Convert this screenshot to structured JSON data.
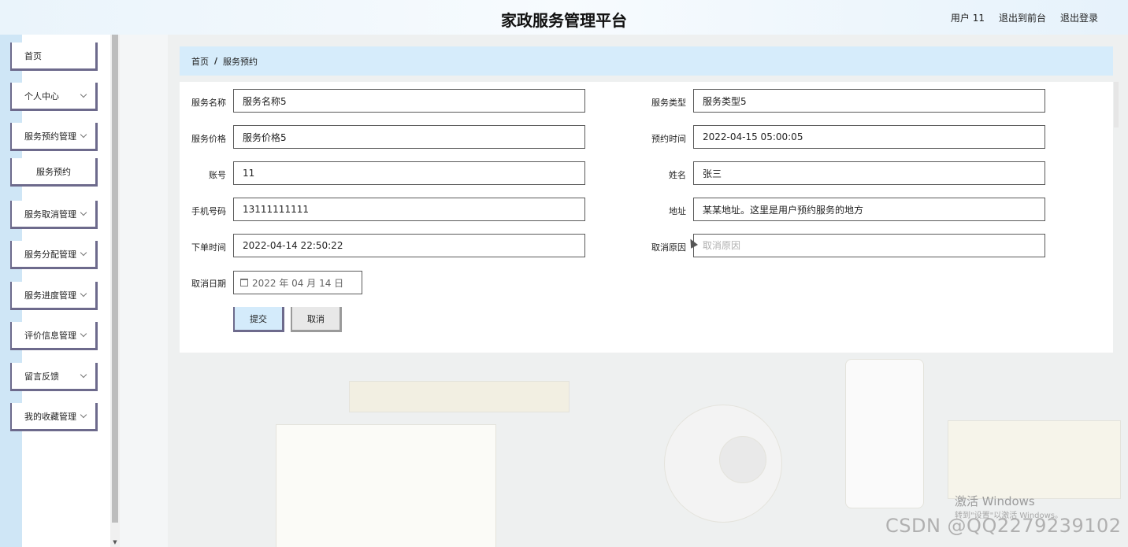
{
  "header": {
    "title": "家政服务管理平台",
    "user": "用户 11",
    "to_front": "退出到前台",
    "logout": "退出登录"
  },
  "sidebar": {
    "items": [
      {
        "label": "首页"
      },
      {
        "label": "个人中心"
      },
      {
        "label": "服务预约管理"
      },
      {
        "label": "服务预约"
      },
      {
        "label": "服务取消管理"
      },
      {
        "label": "服务分配管理"
      },
      {
        "label": "服务进度管理"
      },
      {
        "label": "评价信息管理"
      },
      {
        "label": "留言反馈"
      },
      {
        "label": "我的收藏管理"
      }
    ]
  },
  "breadcrumb": {
    "home": "首页",
    "separator": "/",
    "current": "服务预约"
  },
  "form": {
    "service_name": {
      "label": "服务名称",
      "value": "服务名称5"
    },
    "service_type": {
      "label": "服务类型",
      "value": "服务类型5"
    },
    "service_price": {
      "label": "服务价格",
      "value": "服务价格5"
    },
    "booking_time": {
      "label": "预约时间",
      "value": "2022-04-15 05:00:05"
    },
    "account": {
      "label": "账号",
      "value": "11"
    },
    "name": {
      "label": "姓名",
      "value": "张三"
    },
    "phone": {
      "label": "手机号码",
      "value": "13111111111"
    },
    "address": {
      "label": "地址",
      "value": "某某地址。这里是用户预约服务的地方"
    },
    "order_time": {
      "label": "下单时间",
      "value": "2022-04-14 22:50:22"
    },
    "cancel_reason": {
      "label": "取消原因",
      "value": "",
      "placeholder": "取消原因"
    },
    "cancel_date": {
      "label": "取消日期",
      "value": "2022 年 04 月 14 日"
    },
    "submit_label": "提交",
    "cancel_label": "取消"
  },
  "watermarks": {
    "activate_title": "激活 Windows",
    "activate_sub": "转到\"设置\"以激活 Windows。",
    "csdn": "CSDN @QQ2279239102"
  },
  "colors": {
    "accent_light": "#d6ecfb",
    "menu_border": "#6d6a8c"
  }
}
